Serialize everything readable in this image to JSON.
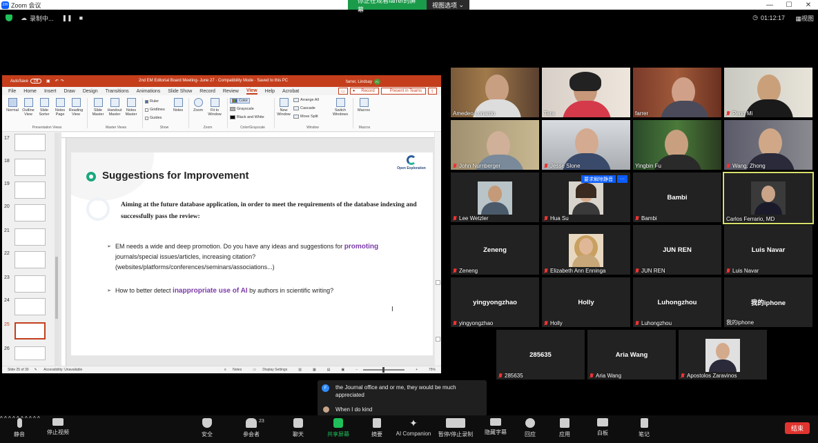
{
  "window": {
    "title": "Zoom 会议",
    "share_banner": "你正在观看farrer的屏幕",
    "view_options": "视图选项",
    "controls": [
      "—",
      "☐",
      "✕"
    ]
  },
  "status": {
    "recording": "录制中...",
    "timer": "01:12:17",
    "view": "视图"
  },
  "ppt": {
    "autosave": "AutoSave",
    "autosave_state": "Off",
    "doc_title": "2nd EM Editorial Board Meeting- June 27  ·  Compatibility Mode  ·  Saved to this PC",
    "user": "farrer, Lindsay",
    "user_initials": "FL",
    "menu": [
      "File",
      "Home",
      "Insert",
      "Draw",
      "Design",
      "Transitions",
      "Animations",
      "Slide Show",
      "Record",
      "Review",
      "View",
      "Help",
      "Acrobat"
    ],
    "record_btn": "Record",
    "present_btn": "Present in Teams",
    "ribbon": {
      "presentation_views": [
        "Normal",
        "Outline View",
        "Slide Sorter",
        "Notes Page",
        "Reading View"
      ],
      "master_views": [
        "Slide Master",
        "Handout Master",
        "Notes Master"
      ],
      "show": [
        "Ruler",
        "Gridlines",
        "Guides"
      ],
      "notes": "Notes",
      "zoom": [
        "Zoom",
        "Fit to Window"
      ],
      "color": [
        "Color",
        "Grayscale",
        "Black and White"
      ],
      "window": [
        "New Window",
        "Arrange All",
        "Cascade",
        "Move Split"
      ],
      "switch": "Switch Windows",
      "macros": "Macros",
      "groups": [
        "Presentation Views",
        "Master Views",
        "Show",
        "Zoom",
        "Color/Grayscale",
        "Window",
        "Macros"
      ]
    },
    "thumbs": [
      "17",
      "18",
      "19",
      "20",
      "21",
      "22",
      "23",
      "24",
      "25",
      "26"
    ],
    "slide": {
      "title": "Suggestions for Improvement",
      "logo": "Open Exploration",
      "paragraph": "Aiming at the future database application, in order to meet the requirements of the database indexing and successfully pass the review:",
      "bullet1_pre": "EM needs a wide and deep promotion. Do you have any ideas and suggestions for ",
      "bullet1_hl": "promoting",
      "bullet1_post": " journals/special issues/articles, increasing citation? (websites/platforms/conferences/seminars/associations...)",
      "bullet2_pre": "How to better detect ",
      "bullet2_hl": "inappropriate use of AI",
      "bullet2_post": " by authors in scientific writing?"
    },
    "statusbar": {
      "slide": "Slide 25 of 30",
      "access": "Accessibility: Unavailable",
      "notes": "Notes",
      "display": "Display Settings",
      "zoom": "75%"
    }
  },
  "participants": [
    {
      "name": "Amedeo Lonardo",
      "muted": false
    },
    {
      "name": "Tara",
      "muted": false
    },
    {
      "name": "farrer",
      "muted": false
    },
    {
      "name": "Peng Mi",
      "muted": true
    },
    {
      "name": "John Nurnberger",
      "muted": true
    },
    {
      "name": "Jesse Slone",
      "muted": true
    },
    {
      "name": "Yingbin Fu",
      "muted": true
    },
    {
      "name": "Wang, Zhong",
      "muted": true
    },
    {
      "name": "Lee Wetzler",
      "muted": true
    },
    {
      "name": "Hua Su",
      "muted": true
    },
    {
      "name": "Bambi",
      "center": "Bambi",
      "muted": true
    },
    {
      "name": "Carlos Ferrario, MD",
      "muted": false
    },
    {
      "name": "Zeneng",
      "center": "Zeneng",
      "muted": true
    },
    {
      "name": "Elizabeth Ann Enninga",
      "muted": true
    },
    {
      "name": "JUN REN",
      "center": "JUN REN",
      "muted": true
    },
    {
      "name": "Luis Navar",
      "center": "Luis Navar",
      "muted": true
    },
    {
      "name": "yingyongzhao",
      "center": "yingyongzhao",
      "muted": true
    },
    {
      "name": "Holly",
      "center": "Holly",
      "muted": true
    },
    {
      "name": "Luhongzhou",
      "center": "Luhongzhou",
      "muted": true
    },
    {
      "name": "我的iphone",
      "center": "我的iphone",
      "muted": false
    },
    {
      "name": "285635",
      "center": "285635",
      "muted": true
    },
    {
      "name": "Aria Wang",
      "center": "Aria Wang",
      "muted": true
    },
    {
      "name": "Apostolos Zaravinos",
      "muted": true
    }
  ],
  "hua_request": "要求解除静音",
  "hua_more": "···",
  "chat": {
    "initial": "F",
    "msg1": "the Journal office and or me, they would be much appreciated",
    "msg2": "When I do kind"
  },
  "toolbar": {
    "mute": "静音",
    "video": "停止视频",
    "security": "安全",
    "participants": "参会者",
    "participants_count": "23",
    "chat": "聊天",
    "share": "共享屏幕",
    "summary": "摘要",
    "ai": "AI Companion",
    "record": "暂停/停止录制",
    "captions": "隐藏字幕",
    "reactions": "回应",
    "apps": "应用",
    "whiteboard": "白板",
    "notes": "笔记",
    "end": "结束"
  },
  "colors": {
    "ppt_red": "#c43e1c",
    "zoom_green": "#1a9b4a",
    "highlight_purple": "#7b3aa8",
    "active_speaker": "#d8e06b",
    "end_red": "#e0342e"
  }
}
